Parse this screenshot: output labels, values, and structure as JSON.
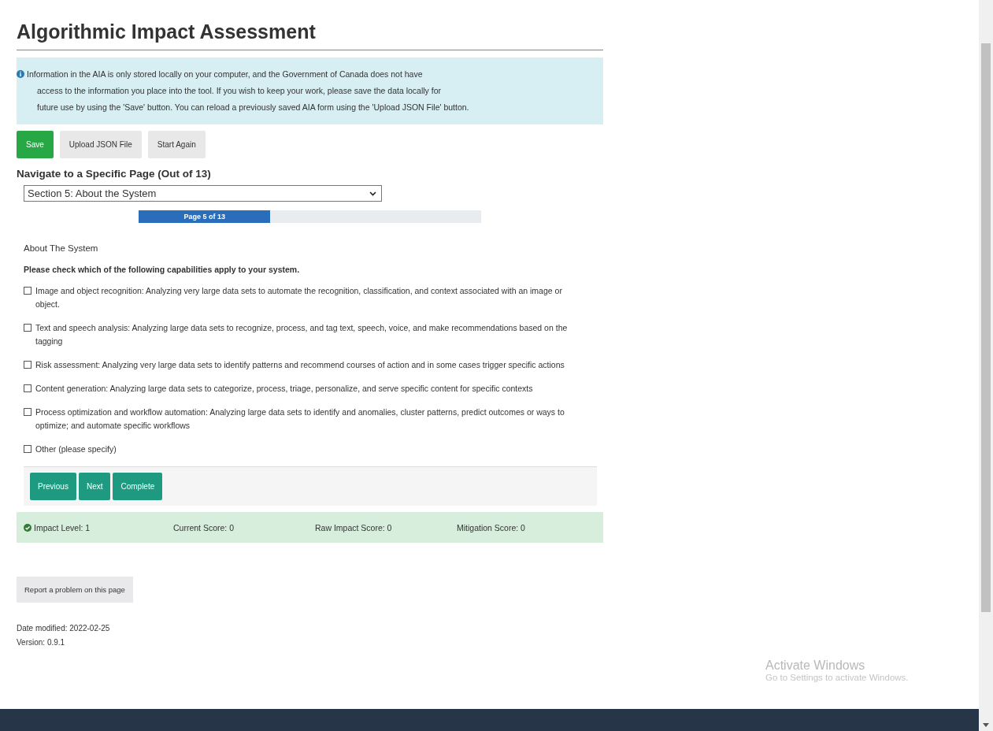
{
  "title": "Algorithmic Impact Assessment",
  "notice": {
    "lines": [
      "Information in the AIA is only stored locally on your computer, and the Government of Canada does not have",
      "access to the information you place into the tool. If you wish to keep your work, please save the data locally for",
      "future use by using the 'Save' button. You can reload a previously saved AIA form using the 'Upload JSON File' button."
    ]
  },
  "actions": [
    {
      "label": "Save",
      "kind": "primary"
    },
    {
      "label": "Upload JSON File",
      "kind": "default"
    },
    {
      "label": "Start Again",
      "kind": "default"
    }
  ],
  "navigate": {
    "heading": "Navigate to a Specific Page (Out of 13)",
    "value": "Section 5: About the System"
  },
  "progress": {
    "label": "Page 5 of 13",
    "level": 0.385
  },
  "section": {
    "title": "About The System",
    "question": "Please check which of the following capabilities apply to your system."
  },
  "options": [
    {
      "label": "Image and object recognition: Analyzing very large data sets to automate the recognition, classification, and context associated with an image or object.",
      "checked": false
    },
    {
      "label": "Text and speech analysis: Analyzing large data sets to recognize, process, and tag text, speech, voice, and make recommendations based on the tagging",
      "checked": false
    },
    {
      "label": "Risk assessment: Analyzing very large data sets to identify patterns and recommend courses of action and in some cases trigger specific actions",
      "checked": false
    },
    {
      "label": "Content generation: Analyzing large data sets to categorize, process, triage, personalize, and serve specific content for specific contexts",
      "checked": false
    },
    {
      "label": "Process optimization and workflow automation: Analyzing large data sets to identify and anomalies, cluster patterns, predict outcomes or ways to optimize; and automate specific workflows",
      "checked": false
    },
    {
      "label": "Other (please specify)",
      "checked": false
    }
  ],
  "nav_buttons": [
    "Previous",
    "Next",
    "Complete"
  ],
  "scores": [
    "Impact Level: 1",
    "Current Score: 0",
    "Raw Impact Score: 0",
    "Mitigation Score: 0"
  ],
  "report_button": "Report a problem on this page",
  "date_modified": "Date modified: 2022-02-25",
  "version": "Version: 0.9.1",
  "activation": {
    "title": "Activate Windows",
    "subtitle": "Go to Settings to activate Windows."
  }
}
